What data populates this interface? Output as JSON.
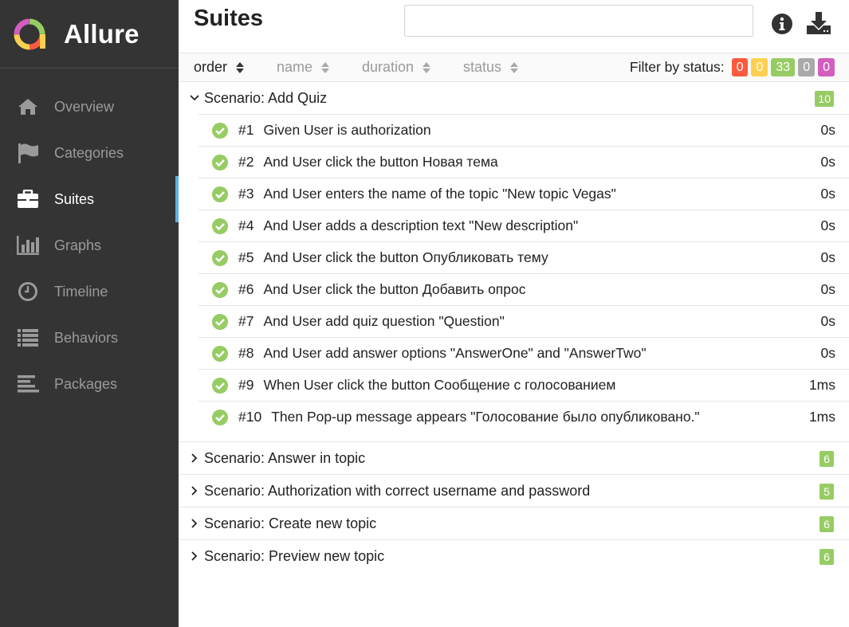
{
  "app": {
    "name": "Allure"
  },
  "sidebar": {
    "items": [
      {
        "label": "Overview",
        "icon": "home-icon"
      },
      {
        "label": "Categories",
        "icon": "flag-icon"
      },
      {
        "label": "Suites",
        "icon": "briefcase-icon",
        "active": true
      },
      {
        "label": "Graphs",
        "icon": "bar-chart-icon"
      },
      {
        "label": "Timeline",
        "icon": "clock-icon"
      },
      {
        "label": "Behaviors",
        "icon": "list-icon"
      },
      {
        "label": "Packages",
        "icon": "align-left-icon"
      }
    ]
  },
  "header": {
    "title": "Suites",
    "search_value": "",
    "info_icon": "info-icon",
    "download_icon": "download-icon"
  },
  "sortbar": {
    "columns": [
      "order",
      "name",
      "duration",
      "status"
    ],
    "filter_label": "Filter by status:",
    "badges": [
      {
        "value": "0",
        "color": "#fd5a3e"
      },
      {
        "value": "0",
        "color": "#ffd050"
      },
      {
        "value": "33",
        "color": "#97cc64"
      },
      {
        "value": "0",
        "color": "#aaaaaa"
      },
      {
        "value": "0",
        "color": "#d35ebe"
      }
    ]
  },
  "groups": [
    {
      "title": "Scenario: Add Quiz",
      "count": "10",
      "expanded": true,
      "cases": [
        {
          "num": "#1",
          "name": "Given User is authorization",
          "duration": "0s"
        },
        {
          "num": "#2",
          "name": "And User click the button Новая тема",
          "duration": "0s"
        },
        {
          "num": "#3",
          "name": "And User enters the name of the topic \"New topic Vegas\"",
          "duration": "0s"
        },
        {
          "num": "#4",
          "name": "And User adds a description text \"New description\"",
          "duration": "0s"
        },
        {
          "num": "#5",
          "name": "And User click the button Опубликовать тему",
          "duration": "0s"
        },
        {
          "num": "#6",
          "name": "And User click the button Добавить опрос",
          "duration": "0s"
        },
        {
          "num": "#7",
          "name": "And User add quiz question \"Question\"",
          "duration": "0s"
        },
        {
          "num": "#8",
          "name": "And User add answer options \"AnswerOne\" and \"AnswerTwo\"",
          "duration": "0s"
        },
        {
          "num": "#9",
          "name": "When User click the button Сообщение с голосованием",
          "duration": "1ms"
        },
        {
          "num": "#10",
          "name": "Then Pop-up message appears \"Голосование было опубликовано.\"",
          "duration": "1ms"
        }
      ]
    },
    {
      "title": "Scenario: Answer in topic",
      "count": "6",
      "expanded": false
    },
    {
      "title": "Scenario: Authorization with correct username and password",
      "count": "5",
      "expanded": false
    },
    {
      "title": "Scenario: Create new topic",
      "count": "6",
      "expanded": false
    },
    {
      "title": "Scenario: Preview new topic",
      "count": "6",
      "expanded": false
    }
  ]
}
